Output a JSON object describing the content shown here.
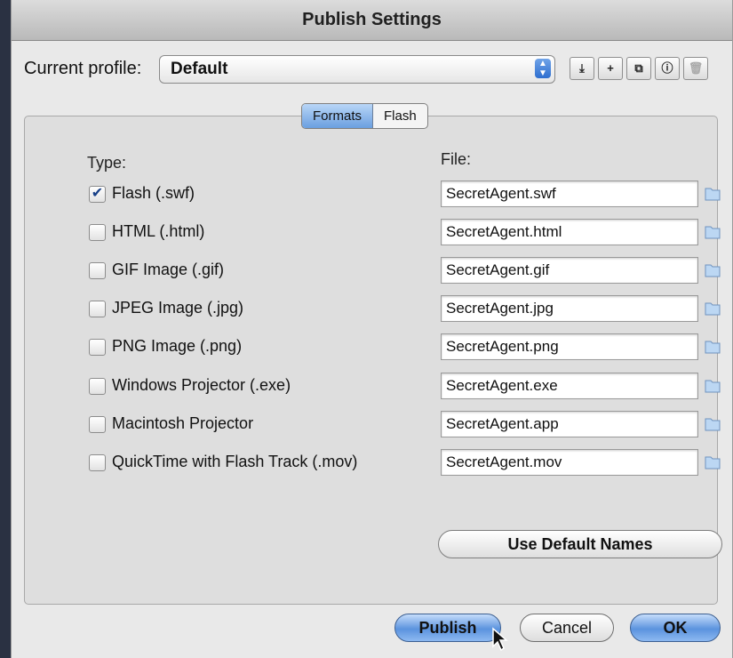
{
  "window": {
    "title": "Publish Settings"
  },
  "profile": {
    "label": "Current profile:",
    "value": "Default"
  },
  "toolbar": {
    "icons": [
      "import-export-icon",
      "add-icon",
      "duplicate-icon",
      "info-icon",
      "trash-icon"
    ]
  },
  "tabs": [
    {
      "label": "Formats",
      "active": true
    },
    {
      "label": "Flash",
      "active": false
    }
  ],
  "formats": {
    "type_header": "Type:",
    "file_header": "File:",
    "rows": [
      {
        "label": "Flash  (.swf)",
        "file": "SecretAgent.swf",
        "checked": true
      },
      {
        "label": "HTML (.html)",
        "file": "SecretAgent.html",
        "checked": false
      },
      {
        "label": "GIF Image (.gif)",
        "file": "SecretAgent.gif",
        "checked": false
      },
      {
        "label": "JPEG Image (.jpg)",
        "file": "SecretAgent.jpg",
        "checked": false
      },
      {
        "label": "PNG Image (.png)",
        "file": "SecretAgent.png",
        "checked": false
      },
      {
        "label": "Windows Projector (.exe)",
        "file": "SecretAgent.exe",
        "checked": false
      },
      {
        "label": "Macintosh Projector",
        "file": "SecretAgent.app",
        "checked": false
      },
      {
        "label": "QuickTime with Flash Track (.mov)",
        "file": "SecretAgent.mov",
        "checked": false
      }
    ],
    "default_names_label": "Use Default Names"
  },
  "buttons": {
    "publish": "Publish",
    "cancel": "Cancel",
    "ok": "OK"
  },
  "colors": {
    "accent": "#5b93de",
    "checkmark": "#163f87"
  }
}
